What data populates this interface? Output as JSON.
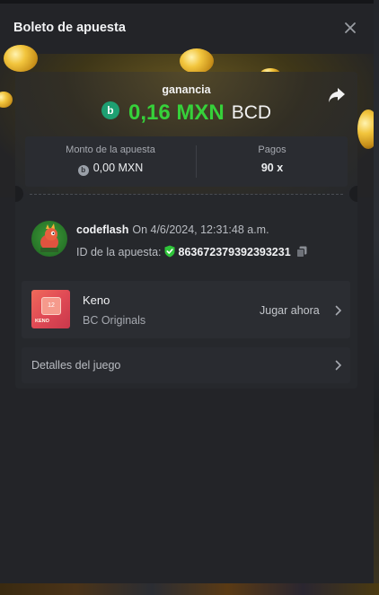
{
  "modal": {
    "title": "Boleto de apuesta"
  },
  "winnings": {
    "label": "ganancia",
    "currency_icon_letter": "b",
    "amount": "0,16 MXN",
    "currency": "BCD",
    "accent_color": "#36d13a"
  },
  "stats": {
    "bet_amount_label": "Monto de la apuesta",
    "bet_amount_value": "0,00 MXN",
    "payout_label": "Pagos",
    "payout_value": "90 x"
  },
  "bet": {
    "username": "codeflash",
    "date": "On 4/6/2024, 12:31:48 a.m.",
    "id_label": "ID de la apuesta:",
    "id_value": "863672379392393231"
  },
  "game": {
    "name": "Keno",
    "provider": "BC Originals",
    "thumb_tile": "12",
    "thumb_label": "KENO",
    "play_label": "Jugar ahora"
  },
  "details": {
    "label": "Detalles del juego"
  },
  "icons": {
    "close": "close-icon",
    "share": "share-icon",
    "verified": "shield-check-icon",
    "copy": "copy-icon",
    "chevron": "chevron-right-icon"
  }
}
